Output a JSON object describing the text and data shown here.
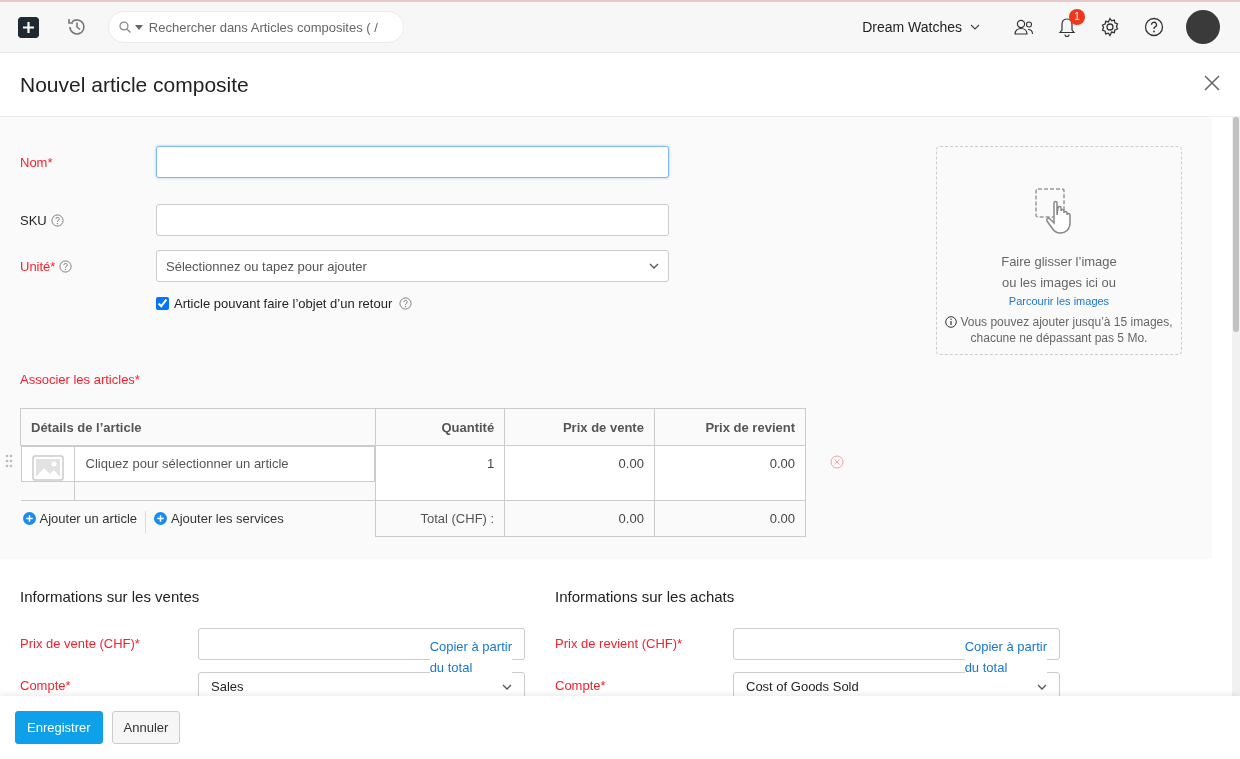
{
  "topbar": {
    "search_placeholder": "Rechercher dans Articles composites ( /",
    "organization": "Dream Watches",
    "notification_count": "1"
  },
  "page": {
    "title": "Nouvel article composite"
  },
  "form": {
    "fields": [
      {
        "kind": "text",
        "label": "Nom*",
        "required": true,
        "help": false,
        "focused": true
      },
      {
        "kind": "text",
        "label": "SKU",
        "required": false,
        "help": true,
        "focused": false
      },
      {
        "kind": "select",
        "label": "Unité*",
        "required": true,
        "help": true,
        "focused": false,
        "placeholder": "Sélectionnez ou tapez pour ajouter"
      }
    ],
    "returnable": {
      "label": "Article pouvant faire l’objet d’un retour",
      "checked": true
    }
  },
  "image_upload": {
    "line_1": "Faire glisser l’image",
    "line_2": "ou les images ici ou",
    "browse_link": "Parcourir les images",
    "note_1": "Vous pouvez ajouter jusqu’à 15 images,",
    "note_2": "chacune ne dépassant pas 5 Mo."
  },
  "items": {
    "heading": "Associer les articles*",
    "columns": [
      "Détails de l’article",
      "Quantité",
      "Prix de vente",
      "Prix de revient"
    ],
    "rows": [
      {
        "placeholder": "Cliquez pour sélectionner un article",
        "quantity": "1",
        "selling_price": "0.00",
        "cost_price": "0.00"
      }
    ],
    "add_links": [
      "Ajouter un article",
      "Ajouter les services"
    ],
    "total_label": "Total (CHF) :",
    "total_selling": "0.00",
    "total_cost": "0.00"
  },
  "sections": [
    {
      "title": "Informations sur les ventes",
      "price_label": "Prix de vente (CHF)*",
      "copy_link_1": "Copier à partir",
      "copy_link_2": "du total",
      "account_label": "Compte*",
      "account_value": "Sales"
    },
    {
      "title": "Informations sur les achats",
      "price_label": "Prix de revient (CHF)*",
      "copy_link_1": "Copier à partir",
      "copy_link_2": "du total",
      "account_label": "Compte*",
      "account_value": "Cost of Goods Sold"
    }
  ],
  "footer": {
    "buttons": [
      {
        "label": "Enregistrer",
        "kind": "primary"
      },
      {
        "label": "Annuler",
        "kind": "secondary"
      }
    ]
  }
}
